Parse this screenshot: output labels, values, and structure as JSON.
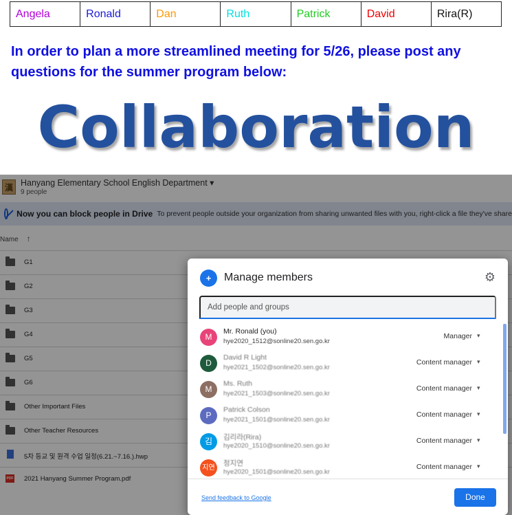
{
  "names": [
    {
      "label": "Angela",
      "color": "#b000d8"
    },
    {
      "label": "Ronald",
      "color": "#1a1ad8"
    },
    {
      "label": "Dan",
      "color": "#ff9900"
    },
    {
      "label": "Ruth",
      "color": "#00e0e0"
    },
    {
      "label": "Patrick",
      "color": "#22cc22"
    },
    {
      "label": "David",
      "color": "#ee0000"
    },
    {
      "label": "Rira(R)",
      "color": "#111111"
    }
  ],
  "heading": "In order to plan a more streamlined meeting for 5/26, please post any questions for the summer program below:",
  "collab_title": "Collaboration",
  "drive": {
    "logo_text": "漢",
    "shared_drive_name": "Hanyang Elementary School English Department ▾",
    "member_count": "9 people",
    "banner_title": "Now you can block people in Drive",
    "banner_text": "To prevent people outside your organization from sharing unwanted files with you, right-click a file they've share",
    "col_name": "Name",
    "sort_arrow": "↑",
    "files": [
      {
        "name": "G1",
        "kind": "folder"
      },
      {
        "name": "G2",
        "kind": "folder"
      },
      {
        "name": "G3",
        "kind": "folder"
      },
      {
        "name": "G4",
        "kind": "folder"
      },
      {
        "name": "G5",
        "kind": "folder"
      },
      {
        "name": "G6",
        "kind": "folder"
      },
      {
        "name": "Other Important Files",
        "kind": "folder"
      },
      {
        "name": "Other Teacher Resources",
        "kind": "folder"
      },
      {
        "name": "5차 등교 및 원격 수업 일정(6.21.~7.16.).hwp",
        "kind": "doc"
      },
      {
        "name": "2021 Hanyang Summer Program.pdf",
        "kind": "pdf"
      }
    ]
  },
  "modal": {
    "icon": "+",
    "title": "Manage members",
    "settings_icon": "⚙",
    "input_placeholder": "Add people and groups",
    "members": [
      {
        "initial": "M",
        "color": "#e8447a",
        "name": "Mr. Ronald (you)",
        "email": "hye2020_1512@sonline20.sen.go.kr",
        "role": "Manager",
        "caret": "▾"
      },
      {
        "initial": "D",
        "color": "#1e5a3c",
        "name": "David R Light",
        "email": "hye2021_1502@sonline20.sen.go.kr",
        "role": "Content manager",
        "caret": "▾"
      },
      {
        "initial": "M",
        "color": "#8d6e63",
        "name": "Ms. Ruth",
        "email": "hye2021_1503@sonline20.sen.go.kr",
        "role": "Content manager",
        "caret": "▾"
      },
      {
        "initial": "P",
        "color": "#5c6bc0",
        "name": "Patrick Colson",
        "email": "hye2021_1501@sonline20.sen.go.kr",
        "role": "Content manager",
        "caret": "▾"
      },
      {
        "initial": "김",
        "color": "#039be5",
        "name": "김리라(Rira)",
        "email": "hye2020_1510@sonline20.sen.go.kr",
        "role": "Content manager",
        "caret": "▾"
      },
      {
        "initial": "지연",
        "color": "#f4511e",
        "name": "정지연",
        "email": "hye2020_1501@sonline20.sen.go.kr",
        "role": "Content manager",
        "caret": "▾"
      }
    ],
    "feedback": "Send feedback to Google",
    "done": "Done"
  }
}
